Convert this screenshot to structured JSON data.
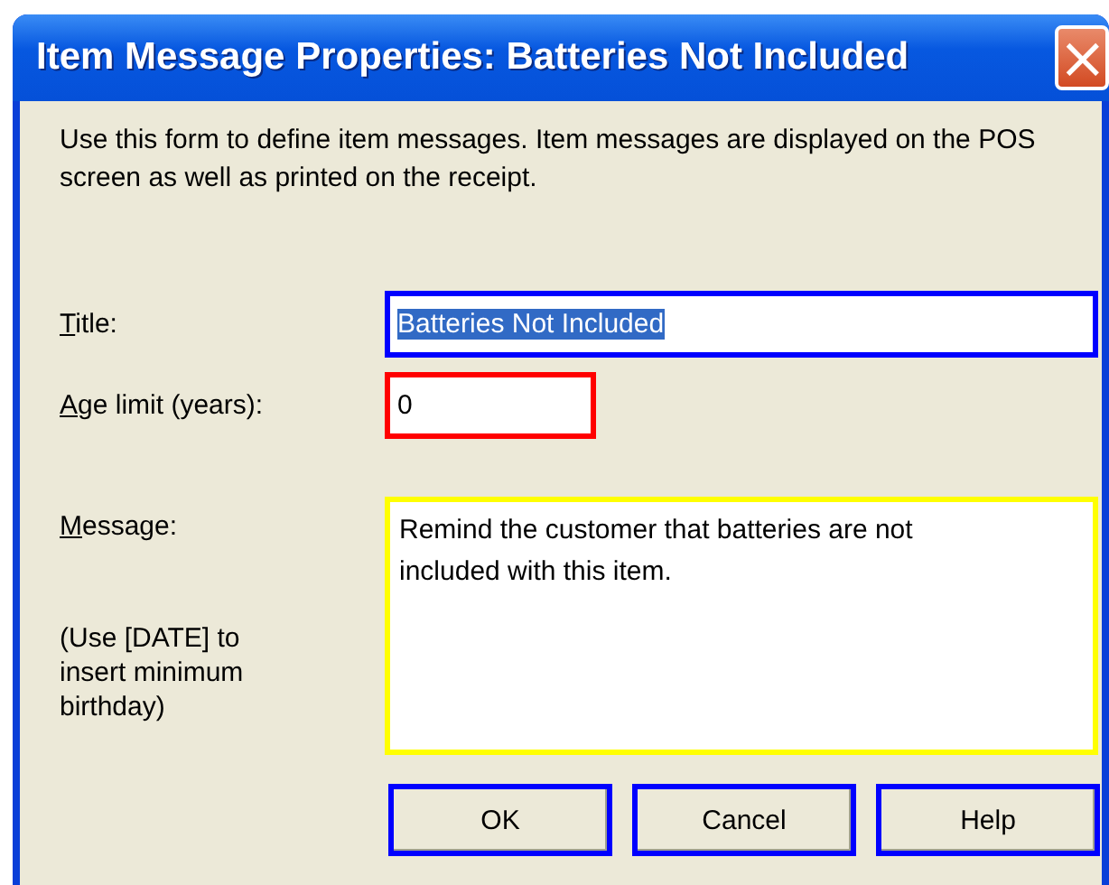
{
  "window": {
    "title": "Item Message Properties: Batteries Not Included",
    "close": "×"
  },
  "description": "Use this form to define item messages.  Item messages are displayed on the POS screen as well as printed on the receipt.",
  "fields": [
    {
      "kind": "text",
      "label": "Title:",
      "access_key_first": true,
      "value": "Batteries Not Included",
      "value_selected": true,
      "color": "#0000ff"
    },
    {
      "kind": "short",
      "label": "Age limit (years):",
      "access_key_first": true,
      "value": "0",
      "value_selected": false,
      "color": "#ff0000"
    },
    {
      "kind": "multiline",
      "label": "Message:",
      "access_key_first": true,
      "hint": "(Use [DATE] to insert minimum birthday)",
      "value": "Remind the customer that batteries are not included with this item.",
      "value_selected": false,
      "color": "#ffff00"
    }
  ],
  "buttons": [
    {
      "label": "OK",
      "color": "#0000ff"
    },
    {
      "label": "Cancel",
      "color": "#0000ff"
    },
    {
      "label": "Help",
      "color": "#0000ff"
    }
  ]
}
